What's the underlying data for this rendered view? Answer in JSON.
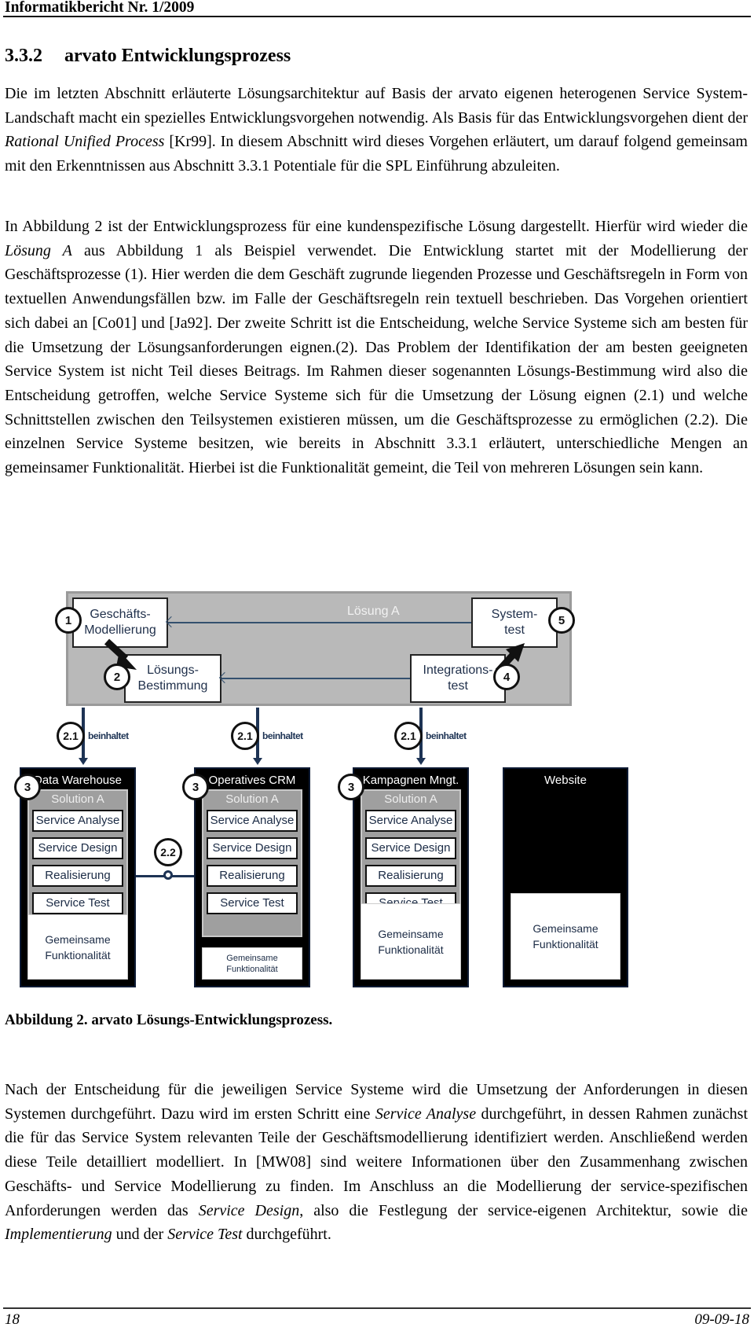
{
  "header": {
    "title": "Informatikbericht Nr. 1/2009"
  },
  "section": {
    "number": "3.3.2",
    "title": "arvato Entwicklungsprozess"
  },
  "paragraphs": {
    "p1": {
      "a": "Die im letzten Abschnitt erläuterte Lösungsarchitektur auf Basis der arvato eigenen heterogenen Service System-Landschaft macht ein spezielles Entwicklungsvorgehen notwendig. Als Basis für das Entwicklungsvorgehen dient der ",
      "b_italic": "Rational Unified Process",
      "c": " [Kr99]. In diesem Abschnitt wird dieses Vorgehen erläutert, um darauf folgend gemeinsam mit den Erkenntnissen aus Abschnitt 3.3.1 Potentiale für die SPL Einführung abzuleiten."
    },
    "p2": {
      "a": "In Abbildung 2 ist der Entwicklungsprozess für eine kundenspezifische Lösung dargestellt. Hierfür wird wieder die ",
      "b_italic": "Lösung A",
      "c": " aus Abbildung 1 als Beispiel verwendet. Die Entwicklung startet mit der Modellierung der Geschäftsprozesse (1). Hier werden die dem Geschäft zugrunde liegenden Prozesse und Geschäftsregeln in Form von textuellen Anwendungsfällen bzw. im Falle der Geschäftsregeln rein textuell beschrieben. Das Vorgehen orientiert sich dabei an [Co01] und [Ja92]. Der zweite Schritt ist die Entscheidung, welche Service Systeme sich am besten für die Umsetzung der Lösungsanforderungen eignen.(2). Das Problem der Identifikation der am besten geeigneten Service System ist nicht Teil dieses Beitrags. Im Rahmen dieser sogenannten Lösungs-Bestimmung wird also die Entscheidung getroffen, welche Service Systeme sich für die Umsetzung der Lösung eignen (2.1) und welche Schnittstellen zwischen den Teilsystemen existieren müssen, um die Geschäftsprozesse zu ermöglichen (2.2). Die einzelnen Service Systeme besitzen, wie bereits in Abschnitt 3.3.1 erläutert, unterschiedliche Mengen an gemeinsamer Funktionalität. Hierbei ist die Funktionalität gemeint, die Teil von mehreren Lösungen sein kann."
    },
    "p3": {
      "a": "Nach der Entscheidung für die jeweiligen Service Systeme wird die Umsetzung der Anforderungen in diesen Systemen durchgeführt. Dazu wird im ersten Schritt eine ",
      "b_italic": "Service Analyse",
      "c": " durchgeführt, in dessen Rahmen zunächst die für das Service System relevanten Teile der Geschäftsmodellierung identifiziert werden. Anschließend werden diese Teile detailliert modelliert. In [MW08] sind weitere Informationen über den Zusammenhang zwischen Geschäfts- und Service Modellierung zu finden. Im Anschluss an die Modellierung der service-spezifischen Anforderungen werden das ",
      "d_italic": "Service Design",
      "e": ", also die Festlegung der service-eigenen Architektur, sowie die ",
      "f_italic": "Implementierung",
      "g": " und der ",
      "h_italic": "Service Test",
      "i": " durchgeführt."
    }
  },
  "figure": {
    "frame_label": "Lösung A",
    "steps": [
      {
        "num": "1",
        "label": "Geschäfts-\nModellierung"
      },
      {
        "num": "2",
        "label": "Lösungs-\nBestimmung"
      },
      {
        "num": "4",
        "label": "Integrations-\ntest"
      },
      {
        "num": "5",
        "label": "System-\ntest"
      }
    ],
    "contains": {
      "num": "2.1",
      "label": "beinhaltet"
    },
    "interface": {
      "num": "2.2"
    },
    "phase_num": "3",
    "solution_label": "Solution A",
    "phases": [
      "Service Analyse",
      "Service Design",
      "Realisierung",
      "Service Test"
    ],
    "common_label": "Gemeinsame\nFunktionalität",
    "systems": [
      {
        "name": "Data Warehouse",
        "common_share": 0.3
      },
      {
        "name": "Operatives CRM",
        "common_share": 0.15
      },
      {
        "name": "Kampagnen Mngt.",
        "common_share": 0.35
      },
      {
        "name": "Website",
        "common_share": 0.4
      }
    ]
  },
  "caption": "Abbildung 2. arvato Lösungs-Entwicklungsprozess.",
  "footer": {
    "page": "18",
    "date": "09-09-18"
  }
}
